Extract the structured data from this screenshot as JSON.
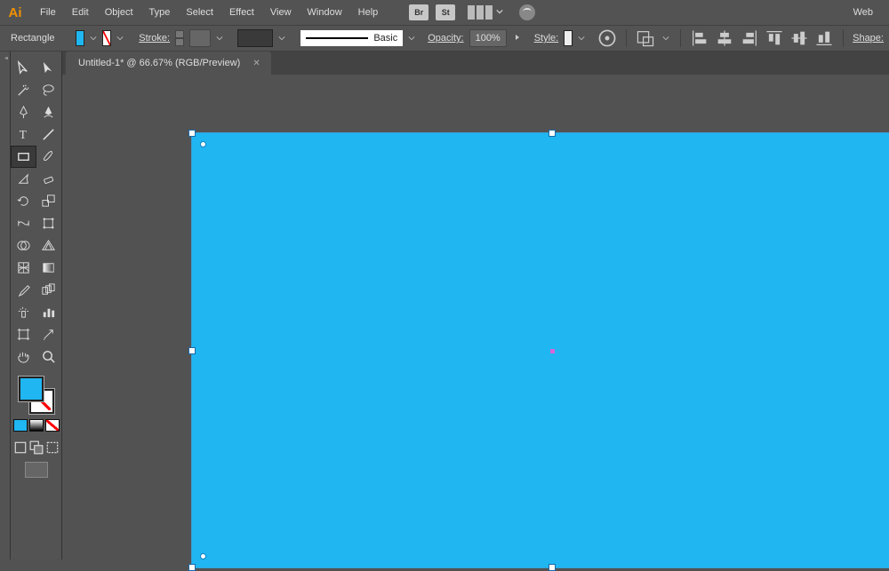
{
  "app": {
    "logo": "Ai",
    "workspace_label": "Web"
  },
  "menu": {
    "items": [
      "File",
      "Edit",
      "Object",
      "Type",
      "Select",
      "Effect",
      "View",
      "Window",
      "Help"
    ],
    "bridge_label": "Br",
    "stock_label": "St"
  },
  "controlbar": {
    "shape_label": "Rectangle",
    "stroke_label": "Stroke:",
    "profile_label": "Basic",
    "opacity_label": "Opacity:",
    "opacity_value": "100%",
    "style_label": "Style:",
    "shape_section_label": "Shape:"
  },
  "tab": {
    "title": "Untitled-1* @ 66.67% (RGB/Preview)"
  },
  "colors": {
    "fill": "#1fb6f2",
    "stroke": "none"
  }
}
